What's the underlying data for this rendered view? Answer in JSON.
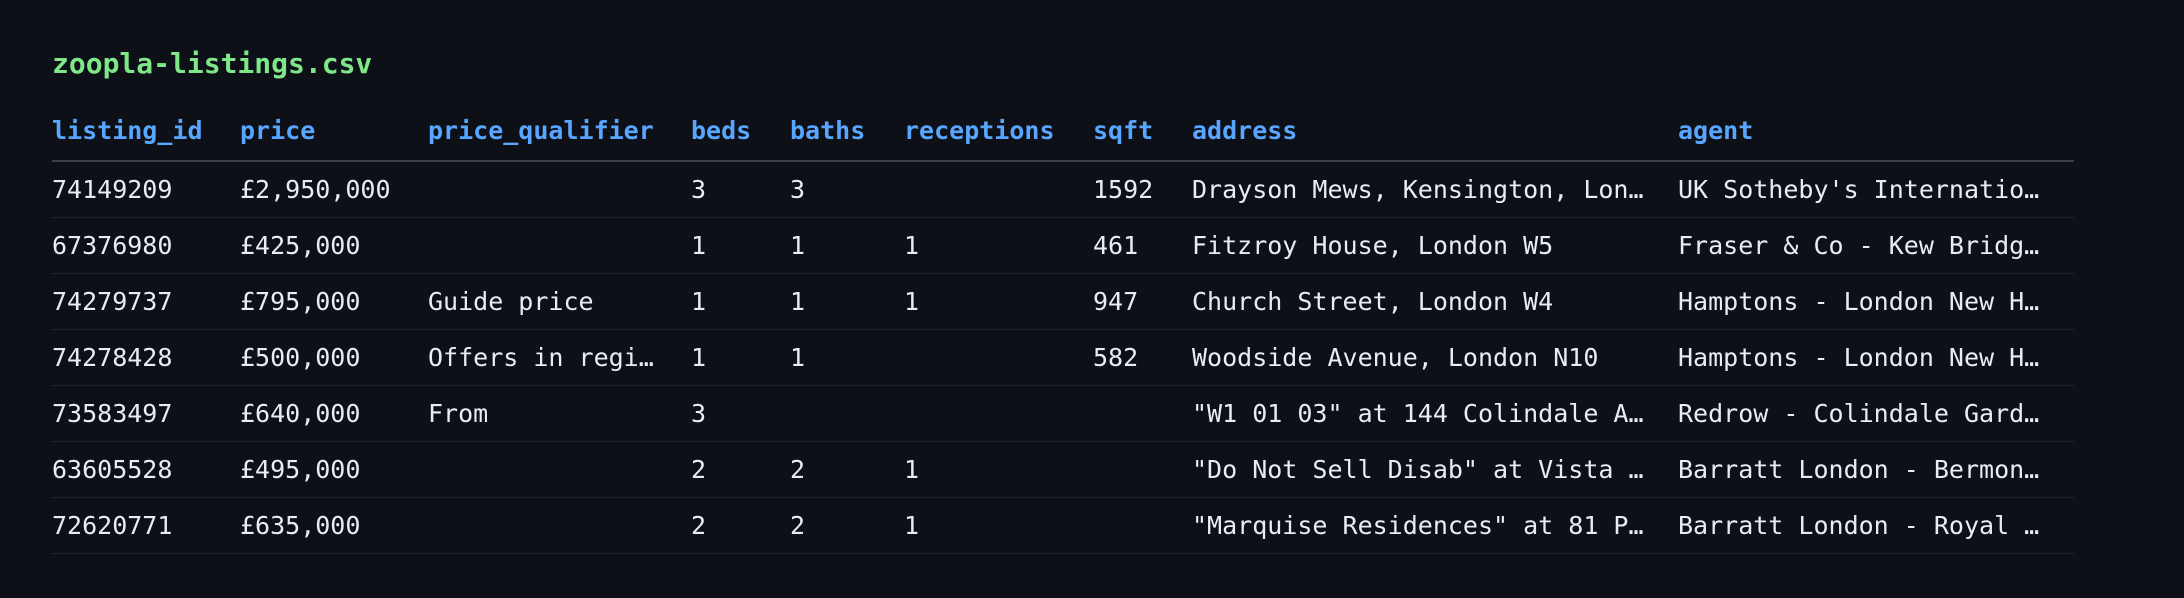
{
  "file": {
    "name": "zoopla-listings.csv"
  },
  "table": {
    "columns": [
      "listing_id",
      "price",
      "price_qualifier",
      "beds",
      "baths",
      "receptions",
      "sqft",
      "address",
      "agent"
    ],
    "rows": [
      [
        "74149209",
        "£2,950,000",
        "",
        "3",
        "3",
        "",
        "1592",
        "Drayson Mews, Kensington, Lon…",
        "UK Sotheby's Internatio…"
      ],
      [
        "67376980",
        "£425,000",
        "",
        "1",
        "1",
        "1",
        "461",
        "Fitzroy House, London W5",
        "Fraser & Co - Kew Bridg…"
      ],
      [
        "74279737",
        "£795,000",
        "Guide price",
        "1",
        "1",
        "1",
        "947",
        "Church Street, London W4",
        "Hamptons - London New H…"
      ],
      [
        "74278428",
        "£500,000",
        "Offers in regi…",
        "1",
        "1",
        "",
        "582",
        "Woodside Avenue, London N10",
        "Hamptons - London New H…"
      ],
      [
        "73583497",
        "£640,000",
        "From",
        "3",
        "",
        "",
        "",
        "\"W1 01 03\" at 144 Colindale A…",
        "Redrow - Colindale Gard…"
      ],
      [
        "63605528",
        "£495,000",
        "",
        "2",
        "2",
        "1",
        "",
        "\"Do Not Sell Disab\" at Vista …",
        "Barratt London - Bermon…"
      ],
      [
        "72620771",
        "£635,000",
        "",
        "2",
        "2",
        "1",
        "",
        "\"Marquise Residences\" at 81 P…",
        "Barratt London - Royal …"
      ]
    ]
  },
  "colors": {
    "background": "#0d1117",
    "title": "#7ee787",
    "header": "#58a6ff",
    "text": "#e6edf3"
  }
}
